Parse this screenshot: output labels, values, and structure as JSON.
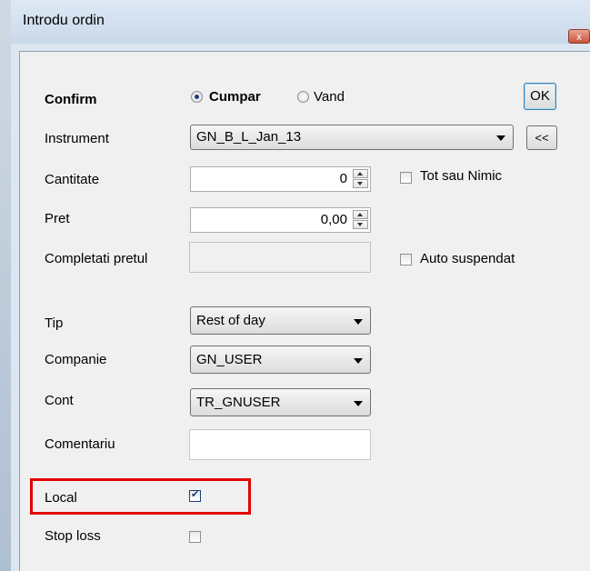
{
  "window": {
    "title": "Introdu ordin",
    "close_glyph": "x"
  },
  "confirm": {
    "label": "Confirm"
  },
  "side": {
    "buy_label": "Cumpar",
    "sell_label": "Vand",
    "selected": "Cumpar"
  },
  "buttons": {
    "ok_label": "OK",
    "collapse_label": "<<"
  },
  "instrument": {
    "label": "Instrument",
    "value": "GN_B_L_Jan_13"
  },
  "quantity": {
    "label": "Cantitate",
    "value": "0"
  },
  "all_or_none": {
    "label": "Tot sau Nimic",
    "checked": false
  },
  "price": {
    "label": "Pret",
    "value": "0,00"
  },
  "fill_price": {
    "label": "Completati pretul",
    "value": ""
  },
  "auto_suspend": {
    "label": "Auto suspendat",
    "checked": false
  },
  "type": {
    "label": "Tip",
    "value": "Rest of day"
  },
  "company": {
    "label": "Companie",
    "value": "GN_USER"
  },
  "account": {
    "label": "Cont",
    "value": "TR_GNUSER"
  },
  "comment": {
    "label": "Comentariu",
    "value": ""
  },
  "local": {
    "label": "Local",
    "checked": true
  },
  "stop_loss": {
    "label": "Stop loss",
    "checked": false
  },
  "colors": {
    "highlight": "#e00000",
    "window_frame": "#dbe6f1",
    "client": "#f0f0f0"
  },
  "icons": {
    "close": "close-icon",
    "dropdown": "chevron-down-icon"
  }
}
